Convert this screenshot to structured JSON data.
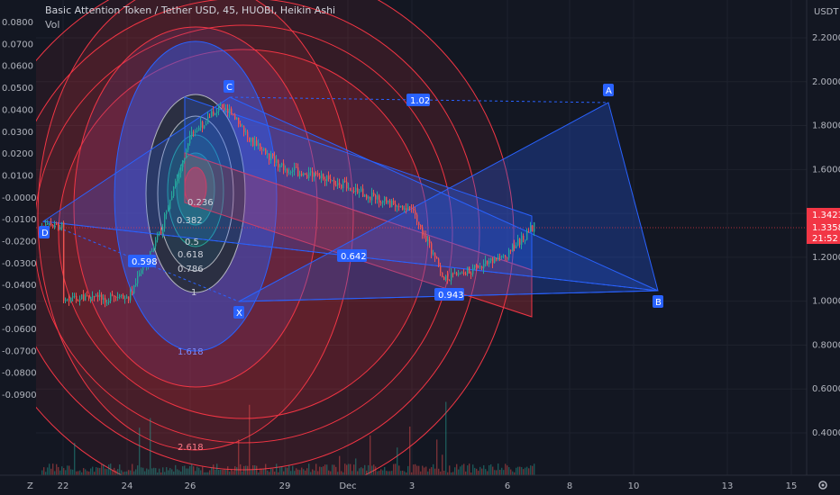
{
  "header": {
    "title": "Basic Attention Token / Tether USD, 45, HUOBI, Heikin Ashi",
    "volume_label": "Vol"
  },
  "left_axis": {
    "ticks": [
      "0.0800",
      "0.0700",
      "0.0600",
      "0.0500",
      "0.0400",
      "0.0300",
      "0.0200",
      "0.0100",
      "-0.0000",
      "-0.0100",
      "-0.0200",
      "-0.0300",
      "-0.0400",
      "-0.0500",
      "-0.0600",
      "-0.0700",
      "-0.0800",
      "-0.0900"
    ]
  },
  "right_axis": {
    "currency": "USDT",
    "ticks": [
      "2.2000",
      "2.0000",
      "1.8000",
      "1.6000",
      "1.4000",
      "1.2000",
      "1.0000",
      "0.8000",
      "0.6000",
      "0.4000"
    ],
    "price_badge": {
      "price": "1.3423",
      "price2": "1.3358",
      "countdown": "21:52",
      "color": "#f23645"
    }
  },
  "x_axis": {
    "ticks": [
      "22",
      "24",
      "26",
      "29",
      "Dec",
      "3",
      "6",
      "8",
      "10",
      "13",
      "15"
    ],
    "left_icon": "Z",
    "right_icon": "gear"
  },
  "fib_levels": [
    "0.236",
    "0.382",
    "0.5",
    "0.618",
    "0.786",
    "1",
    "1.618",
    "2.618"
  ],
  "pattern": {
    "points": {
      "D": "D",
      "C": "C",
      "A": "A",
      "X": "X",
      "B": "B"
    },
    "ratios": {
      "r1": "1.02",
      "r2": "0.598",
      "r3": "0.642",
      "r4": "0.943"
    }
  },
  "colors": {
    "up": "#26a69a",
    "down": "#ef5350",
    "blue": "#2962ff",
    "red": "#f23645"
  },
  "chart_data": {
    "type": "candlestick",
    "title": "Basic Attention Token / Tether USD, 45, HUOBI, Heikin Ashi",
    "price_axis_range": [
      0.4,
      2.2
    ],
    "last_price": 1.3423,
    "x": [
      "22",
      "24",
      "26",
      "29",
      "Dec",
      "3",
      "6",
      "8",
      "10",
      "13",
      "15"
    ],
    "price_path": [
      {
        "x": "22",
        "y": 1.02
      },
      {
        "x": "24",
        "y": 1.01
      },
      {
        "x": "25",
        "y": 1.3
      },
      {
        "x": "26",
        "y": 1.75
      },
      {
        "x": "27",
        "y": 1.9
      },
      {
        "x": "28",
        "y": 1.72
      },
      {
        "x": "29",
        "y": 1.6
      },
      {
        "x": "30",
        "y": 1.57
      },
      {
        "x": "Dec",
        "y": 1.52
      },
      {
        "x": "2",
        "y": 1.46
      },
      {
        "x": "3",
        "y": 1.42
      },
      {
        "x": "4",
        "y": 1.1
      },
      {
        "x": "5",
        "y": 1.15
      },
      {
        "x": "6",
        "y": 1.22
      },
      {
        "x": "7",
        "y": 1.3423
      }
    ]
  }
}
